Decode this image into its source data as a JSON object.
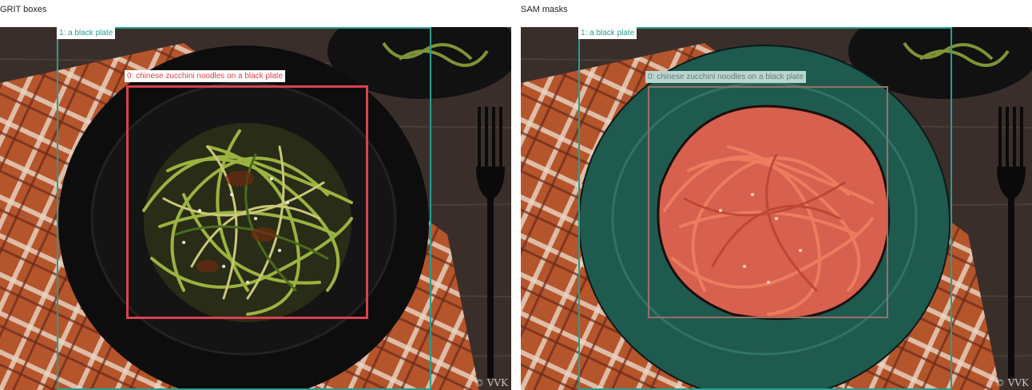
{
  "panels": {
    "left": {
      "title": "GRIT boxes"
    },
    "right": {
      "title": "SAM masks"
    }
  },
  "detections": [
    {
      "label": "0: chinese zucchini noodles on a black plate",
      "color": "#d9424e"
    },
    {
      "label": "1: a black plate",
      "color": "#2a9d8f"
    }
  ],
  "watermark": "© VVK",
  "colors": {
    "table_wood": "#3a2e2a",
    "napkin": "#b5552c",
    "plate": "#0d0d0d",
    "noodles": "#7a8f2e",
    "plate_mask": "#1f5a4f",
    "noodle_mask": "#d8604e"
  }
}
